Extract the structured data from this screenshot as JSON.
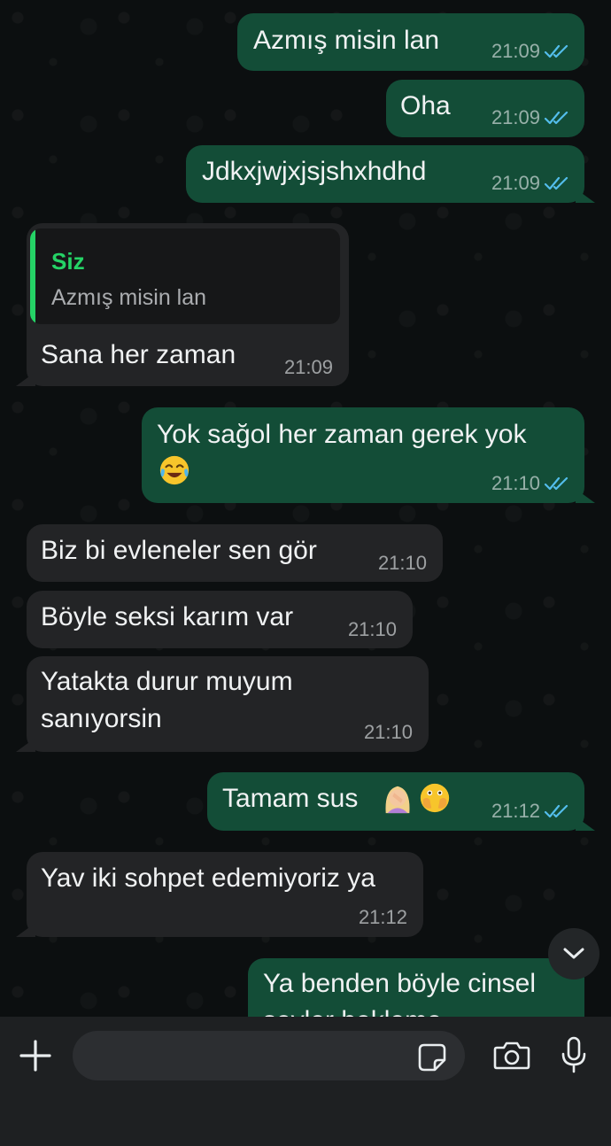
{
  "messages": [
    {
      "text": "Azmış misin lan",
      "time": "21:09",
      "read": true
    },
    {
      "text": "Oha",
      "time": "21:09",
      "read": true
    },
    {
      "text": "Jdkxjwjxjsjshxhdhd",
      "time": "21:09",
      "read": true
    },
    {
      "quote_author": "Siz",
      "quote_text": "Azmış misin lan",
      "text": "Sana her zaman",
      "time": "21:09"
    },
    {
      "line1": "Yok sağol her zaman gerek yok",
      "time": "21:10",
      "read": true
    },
    {
      "text": "Biz bi evleneler sen gör",
      "time": "21:10"
    },
    {
      "text": "Böyle seksi karım var",
      "time": "21:10"
    },
    {
      "line1": "Yatakta durur muyum",
      "line2": "sanıyorsin",
      "time": "21:10"
    },
    {
      "text": "Tamam sus",
      "time": "21:12",
      "read": true
    },
    {
      "text": "Yav iki sohpet edemiyoriz ya",
      "time": "21:12"
    },
    {
      "line1": "Ya benden böyle cinsel",
      "line2": "şeyler bekleme"
    }
  ],
  "emojis": [
    "face-with-tears-of-joy",
    "woman-facepalming",
    "face-with-open-eyes-and-hand-over-mouth"
  ],
  "colors": {
    "outgoing_bubble": "#134d37",
    "incoming_bubble": "#232426",
    "quote_accent": "#25d366",
    "read_ticks": "#53bdeb",
    "input_bar": "#1e2022"
  },
  "input": {
    "placeholder": ""
  },
  "icons": [
    "plus-icon",
    "sticker-icon",
    "camera-icon",
    "microphone-icon",
    "chevron-down-icon",
    "double-check-icon"
  ]
}
